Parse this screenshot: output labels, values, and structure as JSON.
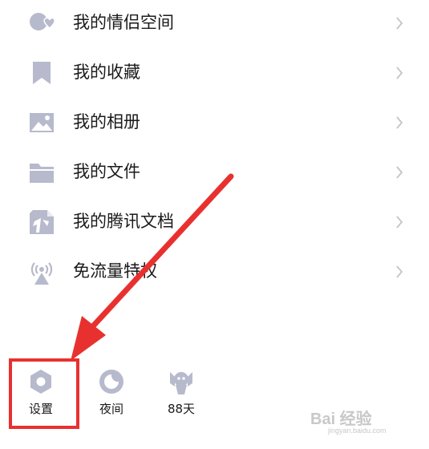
{
  "menu": {
    "items": [
      {
        "label": "我的情侣空间",
        "icon": "couple-space-icon"
      },
      {
        "label": "我的收藏",
        "icon": "bookmark-icon"
      },
      {
        "label": "我的相册",
        "icon": "photo-album-icon"
      },
      {
        "label": "我的文件",
        "icon": "folder-icon"
      },
      {
        "label": "我的腾讯文档",
        "icon": "tencent-docs-icon"
      },
      {
        "label": "免流量特权",
        "icon": "signal-tower-icon"
      }
    ]
  },
  "bottom_bar": {
    "settings_label": "设置",
    "night_label": "夜间",
    "weather_label": "88天"
  },
  "annotation": {
    "color": "#e8312f"
  },
  "watermark": {
    "main": "Bai 经验",
    "sub": "jingyan.baidu.com"
  },
  "colors": {
    "icon": "#b7b9cc",
    "text": "#1a1a1a",
    "chevron": "#c4c4c8"
  }
}
